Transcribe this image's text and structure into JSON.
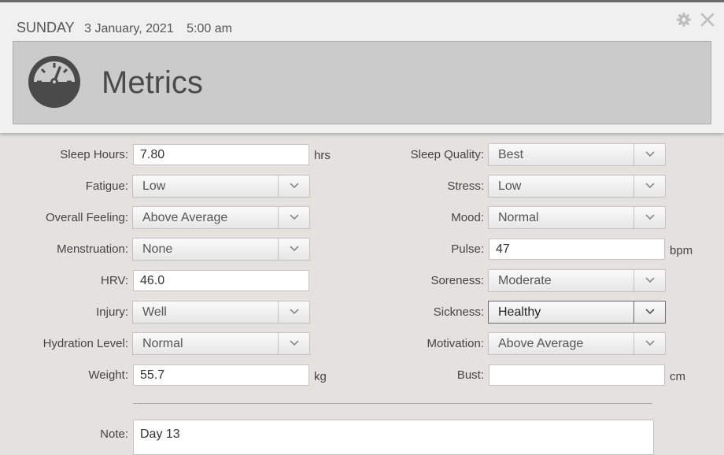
{
  "header": {
    "day": "SUNDAY",
    "date": "3 January, 2021",
    "time": "5:00 am",
    "title": "Metrics",
    "settings_icon": "gear-icon",
    "close_icon": "close-icon",
    "section_icon": "gauge-icon"
  },
  "fields": {
    "sleep_hours": {
      "label": "Sleep Hours:",
      "value": "7.80",
      "unit": "hrs"
    },
    "sleep_quality": {
      "label": "Sleep Quality:",
      "value": "Best"
    },
    "fatigue": {
      "label": "Fatigue:",
      "value": "Low"
    },
    "stress": {
      "label": "Stress:",
      "value": "Low"
    },
    "overall_feeling": {
      "label": "Overall Feeling:",
      "value": "Above Average"
    },
    "mood": {
      "label": "Mood:",
      "value": "Normal"
    },
    "menstruation": {
      "label": "Menstruation:",
      "value": "None"
    },
    "pulse": {
      "label": "Pulse:",
      "value": "47",
      "unit": "bpm"
    },
    "hrv": {
      "label": "HRV:",
      "value": "46.0"
    },
    "soreness": {
      "label": "Soreness:",
      "value": "Moderate"
    },
    "injury": {
      "label": "Injury:",
      "value": "Well"
    },
    "sickness": {
      "label": "Sickness:",
      "value": "Healthy"
    },
    "hydration": {
      "label": "Hydration Level:",
      "value": "Normal"
    },
    "motivation": {
      "label": "Motivation:",
      "value": "Above Average"
    },
    "weight": {
      "label": "Weight:",
      "value": "55.7",
      "unit": "kg"
    },
    "bust": {
      "label": "Bust:",
      "value": "",
      "unit": "cm"
    },
    "note": {
      "label": "Note:",
      "value": "Day 13"
    }
  },
  "colors": {
    "background": "#e3e2df",
    "banner": "#cbcbcb",
    "icon": "#4a4a4a"
  }
}
